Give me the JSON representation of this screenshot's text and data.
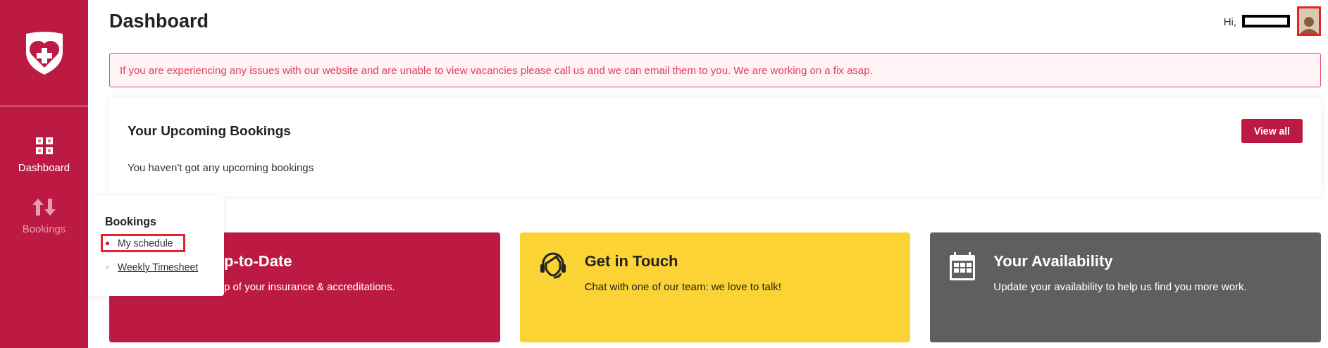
{
  "sidebar": {
    "items": [
      {
        "label": "Dashboard",
        "kind": "grid",
        "selected": true
      },
      {
        "label": "Bookings",
        "kind": "arrows",
        "selected": false
      }
    ]
  },
  "header": {
    "title": "Dashboard",
    "greeting": "Hi,",
    "avatar": {
      "highlighted": true
    }
  },
  "notice": "If you are experiencing any issues with our website and are unable to view vacancies please call us and we can email them to you. We are working on a fix asap.",
  "upcoming": {
    "title": "Your Upcoming Bookings",
    "button": "View all",
    "empty_text": "You haven't got any upcoming bookings"
  },
  "cards": [
    {
      "kind": "covered",
      "title": "p-to-Date",
      "text": "p of your insurance & accreditations.",
      "color": "#bc1a43"
    },
    {
      "kind": "headset",
      "title": "Get in Touch",
      "text": "Chat with one of our team: we love to talk!",
      "color": "#fbd335"
    },
    {
      "kind": "calendar",
      "title": "Your Availability",
      "text": "Update your availability to help us find you more work.",
      "color": "#5f5f5f"
    }
  ],
  "flyout": {
    "title": "Bookings",
    "items": [
      {
        "label": "My schedule",
        "selected": true,
        "highlighted": true
      },
      {
        "label": "Weekly Timesheet",
        "selected": false,
        "highlighted": false
      }
    ]
  }
}
